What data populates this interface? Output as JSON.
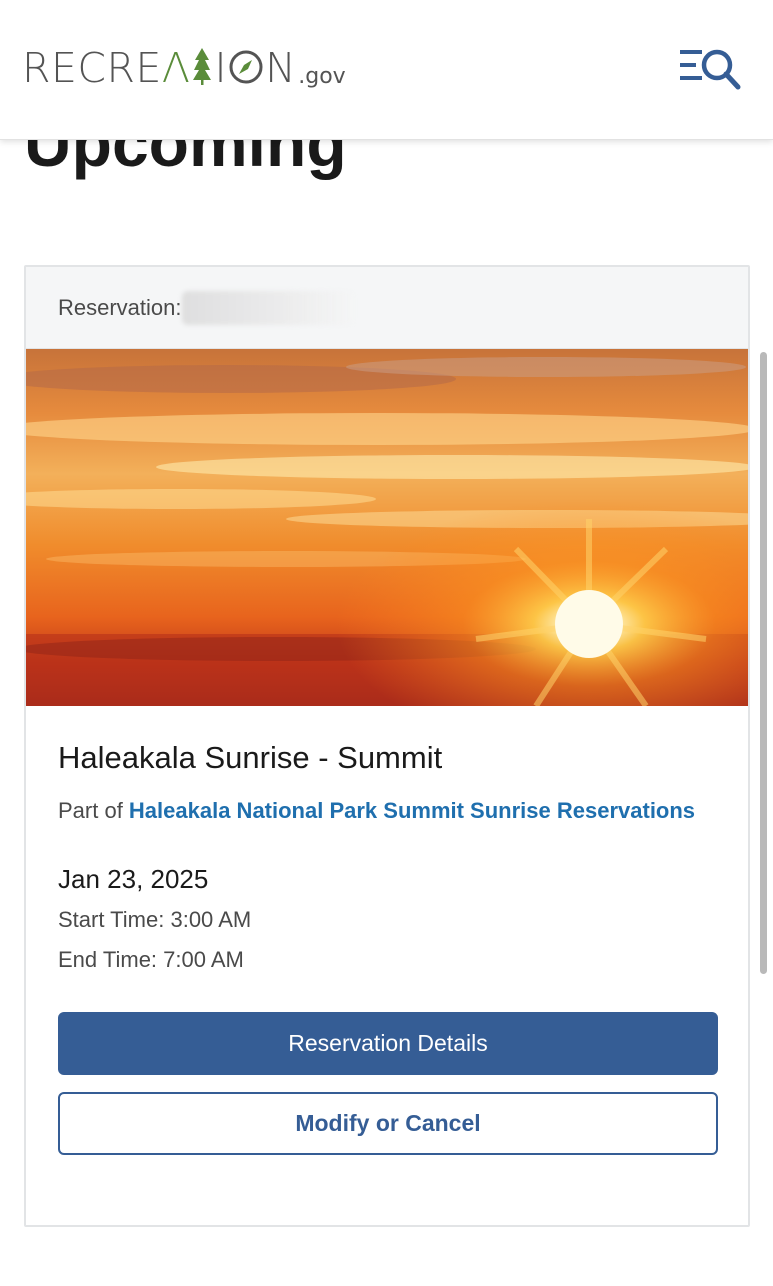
{
  "header": {
    "logo_text_1": "RECRE",
    "logo_text_2": "A",
    "logo_text_3": "I",
    "logo_text_4": "N",
    "logo_suffix": ".gov",
    "menu_icon": "menu-search-icon"
  },
  "page": {
    "heading": "Upcoming"
  },
  "reservation": {
    "label": "Reservation:",
    "image": "sunrise-photo",
    "title": "Haleakala Sunrise - Summit",
    "part_of_prefix": "Part of ",
    "park_link": "Haleakala National Park Summit Sunrise Reservations",
    "date": "Jan 23, 2025",
    "start_time": "Start Time: 3:00 AM",
    "end_time": "End Time: 7:00 AM",
    "details_button": "Reservation Details",
    "modify_button": "Modify or Cancel"
  },
  "colors": {
    "primary": "#355d95",
    "link": "#1f6fae",
    "logo_green": "#5a8c3a"
  }
}
